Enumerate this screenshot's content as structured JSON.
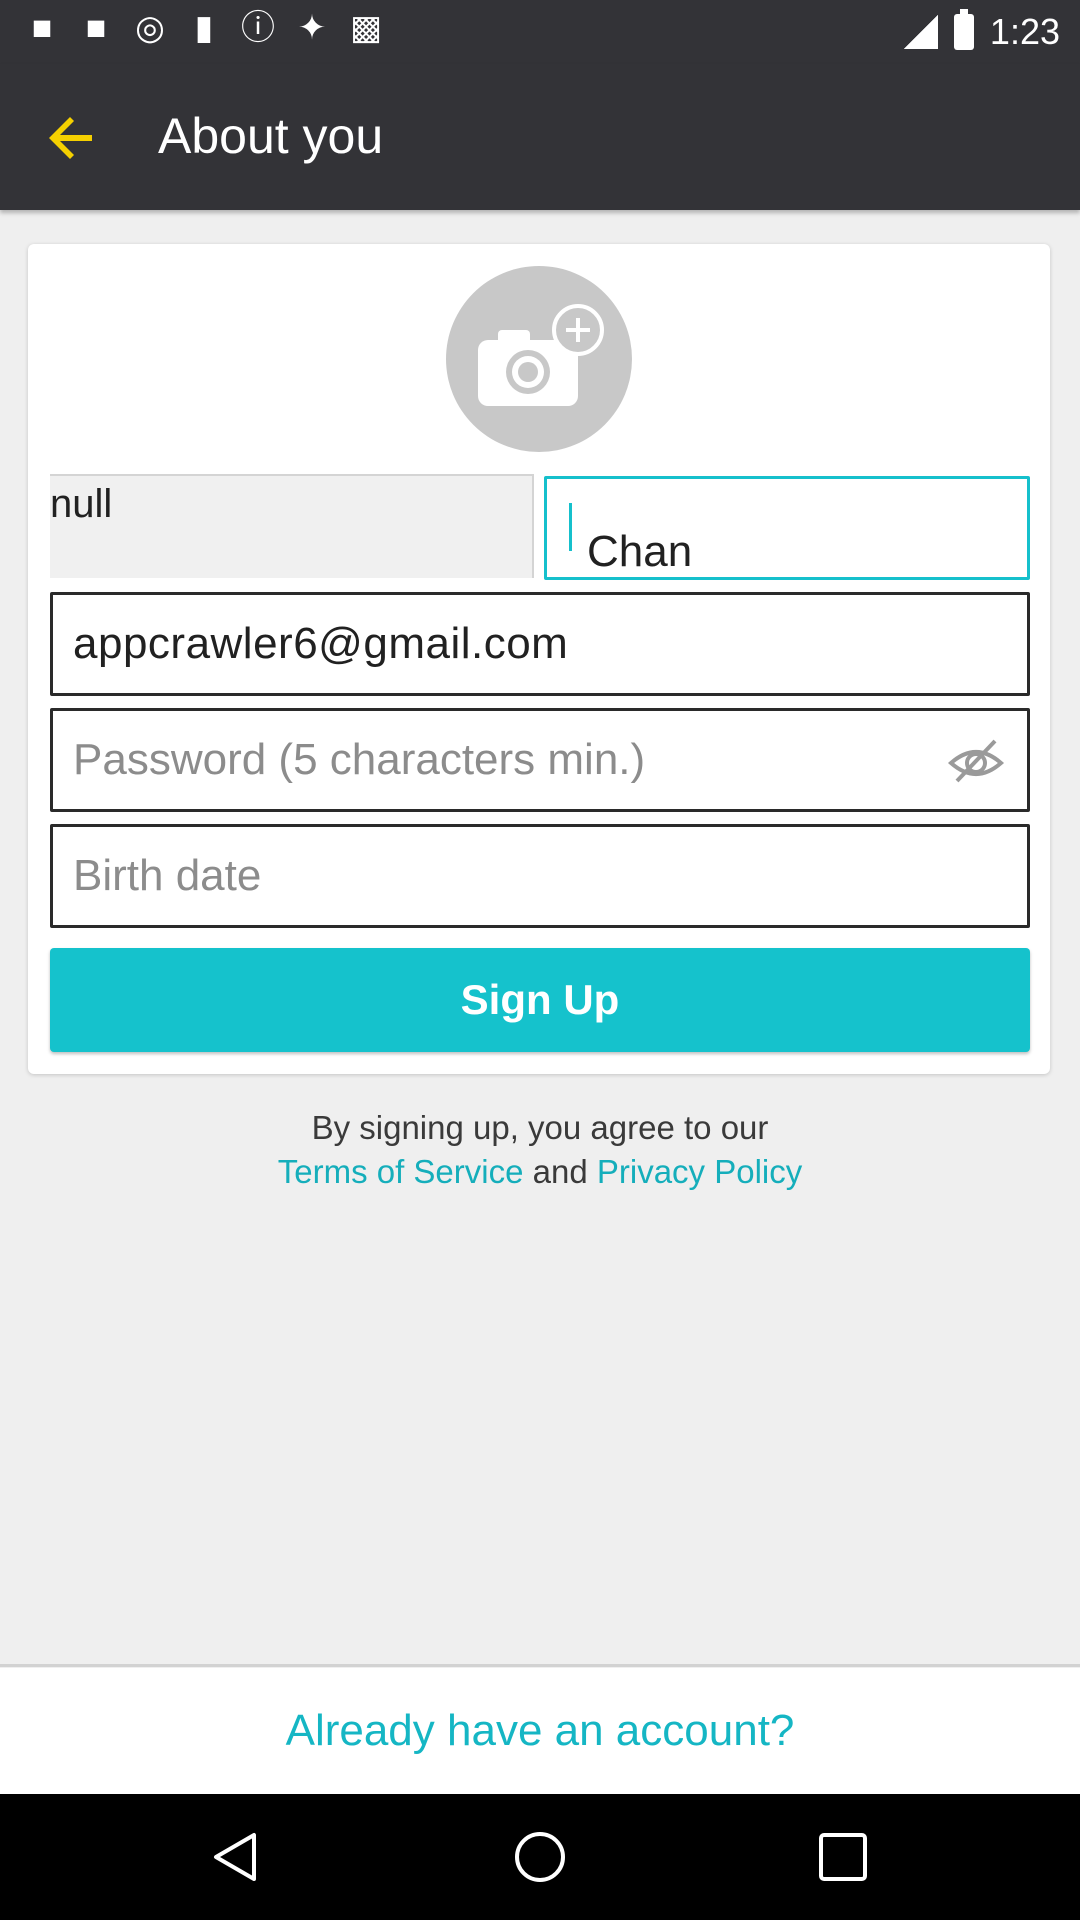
{
  "status_bar": {
    "time": "1:23",
    "icons": [
      "flipboard-icon",
      "flipboard-icon",
      "vpn-globe-icon",
      "lock-icon",
      "info-icon",
      "gps-fake-icon",
      "android-icon"
    ]
  },
  "app_bar": {
    "title": "About you",
    "back_icon": "arrow-back-icon"
  },
  "form": {
    "avatar_icon": "camera-add-icon",
    "first_name_value": "null",
    "last_name_value": "Chan",
    "email_value": "appcrawler6@gmail.com",
    "password_placeholder": "Password (5 characters min.)",
    "password_toggle_icon": "eye-off-icon",
    "birth_date_placeholder": "Birth date",
    "signup_label": "Sign Up"
  },
  "terms": {
    "line1": "By signing up, you agree to our",
    "terms_link": "Terms of Service",
    "and_text": "and",
    "privacy_link": "Privacy Policy"
  },
  "footer": {
    "login_link": "Already have an account?"
  },
  "colors": {
    "accent": "#15c2cc",
    "app_bar": "#333337",
    "back_arrow": "#f5d000"
  }
}
